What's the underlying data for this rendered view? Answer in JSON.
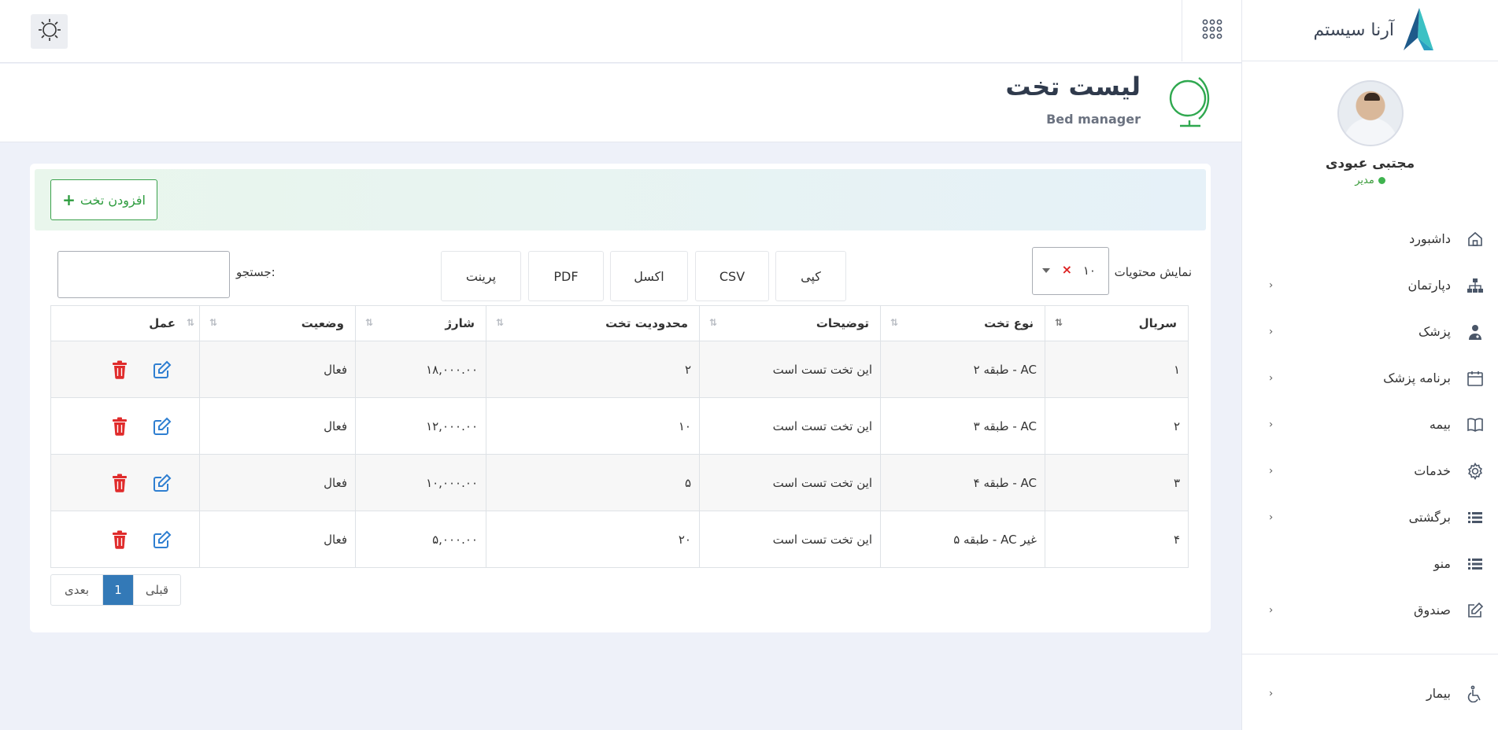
{
  "app": {
    "logo_text": "آرنا سیستم"
  },
  "user": {
    "name": "مجتبی عبودی",
    "role": "مدیر"
  },
  "sidebar": {
    "items": [
      {
        "label": "داشبورد",
        "icon": "home-icon",
        "has_arrow": false
      },
      {
        "label": "دپارتمان",
        "icon": "sitemap-icon",
        "has_arrow": true
      },
      {
        "label": "پزشک",
        "icon": "doctor-icon",
        "has_arrow": true
      },
      {
        "label": "برنامه پزشک",
        "icon": "calendar-icon",
        "has_arrow": true
      },
      {
        "label": "بیمه",
        "icon": "book-icon",
        "has_arrow": true
      },
      {
        "label": "خدمات",
        "icon": "gear-icon",
        "has_arrow": true
      },
      {
        "label": "برگشتی",
        "icon": "list-icon",
        "has_arrow": true
      },
      {
        "label": "منو",
        "icon": "list-icon",
        "has_arrow": false
      },
      {
        "label": "صندوق",
        "icon": "edit-icon",
        "has_arrow": true
      },
      {
        "label": "بیمار",
        "icon": "wheelchair-icon",
        "has_arrow": true
      }
    ]
  },
  "page": {
    "title": "لیست تخت",
    "subtitle": "Bed manager"
  },
  "toolbar": {
    "add_label": "افزودن تخت"
  },
  "controls": {
    "length_label": "نمایش محتویات",
    "length_value": "۱۰",
    "search_label": "جستجو:",
    "export_buttons": [
      "کپی",
      "CSV",
      "اکسل",
      "PDF",
      "پرینت"
    ]
  },
  "table": {
    "headers": [
      "سریال",
      "نوع تخت",
      "توضیحات",
      "محدودیت تخت",
      "شارژ",
      "وضعیت",
      "عمل"
    ],
    "rows": [
      [
        "۱",
        "AC - طبقه ۲",
        "این تخت تست است",
        "۲",
        "۱۸,۰۰۰.۰۰",
        "فعال"
      ],
      [
        "۲",
        "AC - طبقه ۳",
        "این تخت تست است",
        "۱۰",
        "۱۲,۰۰۰.۰۰",
        "فعال"
      ],
      [
        "۳",
        "AC - طبقه ۴",
        "این تخت تست است",
        "۵",
        "۱۰,۰۰۰.۰۰",
        "فعال"
      ],
      [
        "۴",
        "غیر AC - طبقه ۵",
        "این تخت تست است",
        "۲۰",
        "۵,۰۰۰.۰۰",
        "فعال"
      ]
    ]
  },
  "pagination": {
    "prev": "قبلی",
    "current": "1",
    "next": "بعدی"
  },
  "colors": {
    "accent": "#3379b7",
    "success": "#2e9c3f",
    "danger": "#e02b2b",
    "edit": "#2f7fd1"
  }
}
